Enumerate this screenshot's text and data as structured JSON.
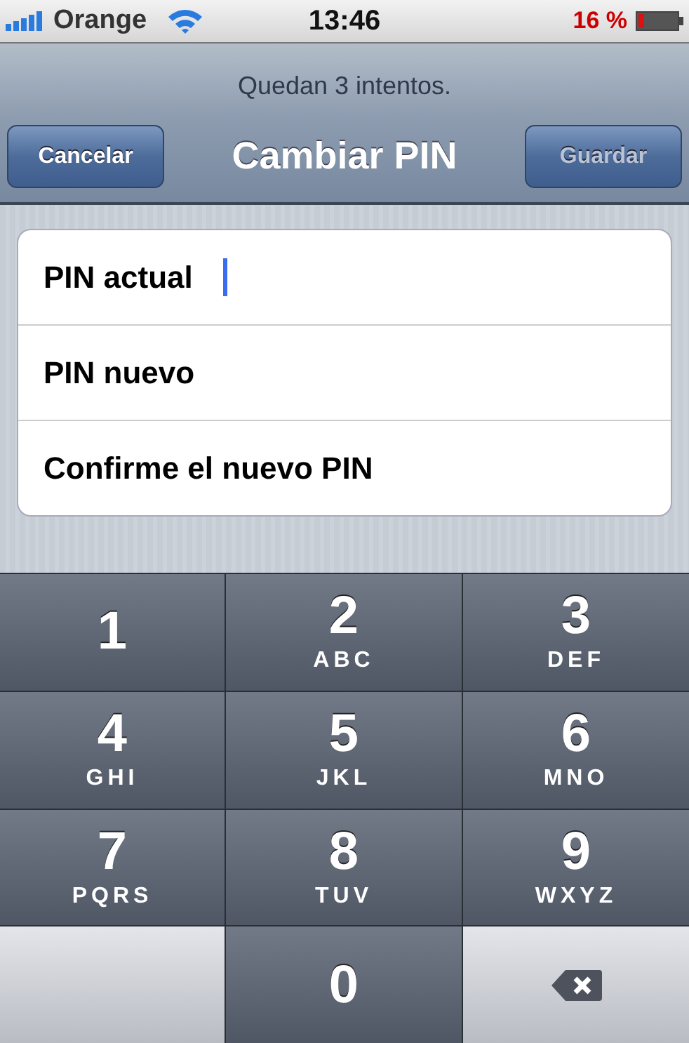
{
  "status_bar": {
    "carrier": "Orange",
    "time": "13:46",
    "battery": "16 %"
  },
  "nav": {
    "prompt": "Quedan 3 intentos.",
    "cancel": {
      "label": "Cancelar",
      "disabled": false
    },
    "title": "Cambiar PIN",
    "save": {
      "label": "Guardar",
      "disabled": true
    }
  },
  "fields": [
    {
      "label": "PIN actual",
      "focused": true
    },
    {
      "label": "PIN nuevo",
      "focused": false
    },
    {
      "label": "Confirme el nuevo PIN",
      "focused": false
    }
  ],
  "keypad": [
    {
      "kind": "digit",
      "digit": "1"
    },
    {
      "kind": "digit",
      "digit": "2",
      "letters": "ABC"
    },
    {
      "kind": "digit",
      "digit": "3",
      "letters": "DEF"
    },
    {
      "kind": "digit",
      "digit": "4",
      "letters": "GHI"
    },
    {
      "kind": "digit",
      "digit": "5",
      "letters": "JKL"
    },
    {
      "kind": "digit",
      "digit": "6",
      "letters": "MNO"
    },
    {
      "kind": "digit",
      "digit": "7",
      "letters": "PQRS"
    },
    {
      "kind": "digit",
      "digit": "8",
      "letters": "TUV"
    },
    {
      "kind": "digit",
      "digit": "9",
      "letters": "WXYZ"
    },
    {
      "kind": "blank"
    },
    {
      "kind": "digit",
      "digit": "0"
    },
    {
      "kind": "delete"
    }
  ]
}
